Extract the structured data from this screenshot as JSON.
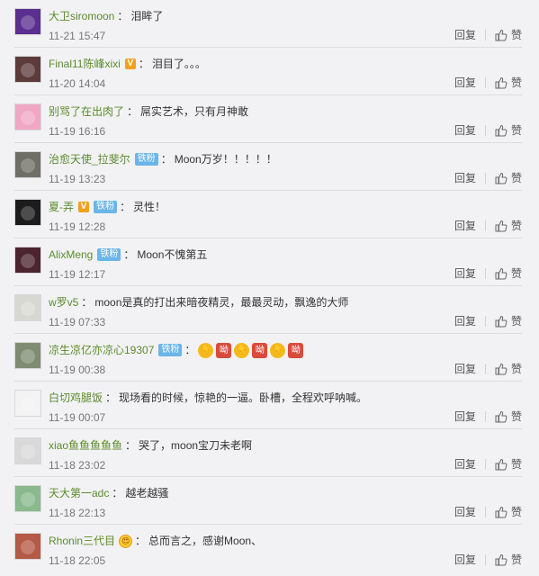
{
  "actions": {
    "reply_label": "回复",
    "like_label": "赞"
  },
  "comments": [
    {
      "username": "大卫siromoon",
      "separator": "：",
      "text": "泪眸了",
      "time": "11-21 15:47",
      "avatar_color": "#5a2f8f",
      "badge_v": false,
      "badge_fan": false
    },
    {
      "username": "Final11陈峰xixi",
      "separator": "：",
      "text": "泪目了。。。",
      "time": "11-20 14:04",
      "avatar_color": "#5d3b3b",
      "badge_v": true,
      "badge_v_text": "V",
      "badge_fan": false
    },
    {
      "username": "别骂了在出肉了",
      "separator": "：",
      "text": "屌实艺术，只有月神敢",
      "time": "11-19 16:16",
      "avatar_color": "#f0a7c4",
      "badge_v": false,
      "badge_fan": false
    },
    {
      "username": "治愈天使_拉斐尔",
      "separator": "：",
      "text": "Moon万岁！！！！！",
      "time": "11-19 13:23",
      "avatar_color": "#6f6f68",
      "badge_v": false,
      "badge_fan": true,
      "badge_fan_text": "铁粉"
    },
    {
      "username": "夏-弄",
      "separator": "：",
      "text": "灵性！",
      "time": "11-19 12:28",
      "avatar_color": "#1c1c1c",
      "badge_v": true,
      "badge_v_text": "V",
      "badge_fan": true,
      "badge_fan_text": "铁粉"
    },
    {
      "username": "AlixMeng",
      "separator": "：",
      "text": "Moon不愧第五",
      "time": "11-19 12:17",
      "avatar_color": "#4c2430",
      "badge_v": false,
      "badge_fan": true,
      "badge_fan_text": "铁粉"
    },
    {
      "username": "w罗v5",
      "separator": "：",
      "text": "moon是真的打出来暗夜精灵，最最灵动，飘逸的大师",
      "time": "11-19 07:33",
      "avatar_color": "#d8d8d2",
      "badge_v": false,
      "badge_fan": false
    },
    {
      "username": "凉生凉亿亦凉心19307",
      "separator": "：",
      "text": "",
      "time": "11-19 00:38",
      "avatar_color": "#7f8c73",
      "badge_v": false,
      "badge_fan": true,
      "badge_fan_text": "铁粉",
      "emojis": [
        {
          "glyph": "👇",
          "kind": "gold"
        },
        {
          "glyph": "呦",
          "kind": "red"
        },
        {
          "glyph": "👇",
          "kind": "gold"
        },
        {
          "glyph": "呦",
          "kind": "red"
        },
        {
          "glyph": "👇",
          "kind": "gold"
        },
        {
          "glyph": "呦",
          "kind": "red"
        }
      ]
    },
    {
      "username": "白切鸡腿饭",
      "separator": "：",
      "text": "现场看的时候，惊艳的一逼。卧槽，全程欢呼呐喊。",
      "time": "11-19 00:07",
      "avatar_color": "#f3f3f3",
      "badge_v": false,
      "badge_fan": false
    },
    {
      "username": "xiao鱼鱼鱼鱼鱼",
      "separator": "：",
      "text": "哭了，moon宝刀未老啊",
      "time": "11-18 23:02",
      "avatar_color": "#d9d9d9",
      "badge_v": false,
      "badge_fan": false
    },
    {
      "username": "天大第一adc",
      "separator": "：",
      "text": "越老越骚",
      "time": "11-18 22:13",
      "avatar_color": "#8ab98d",
      "badge_v": false,
      "badge_fan": false
    },
    {
      "username": "Rhonin三代目",
      "separator": "：",
      "text": "总而言之，感谢Moon、",
      "time": "11-18 22:05",
      "avatar_color": "#b55a46",
      "badge_v": false,
      "badge_fan": false,
      "emoji_face": "😍"
    }
  ]
}
